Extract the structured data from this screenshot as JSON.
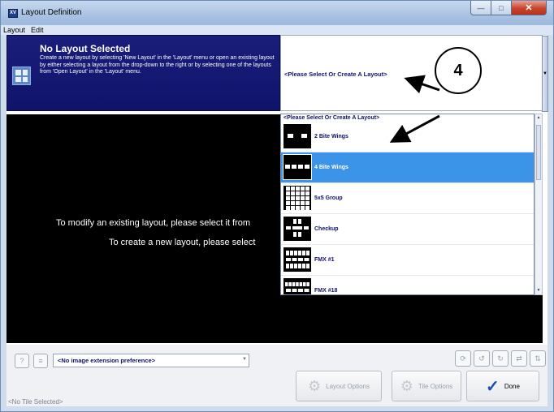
{
  "window": {
    "title": "Layout Definition",
    "icon_text": "XV"
  },
  "menu": {
    "items": [
      "Layout",
      "Edit"
    ]
  },
  "header": {
    "title": "No Layout Selected",
    "description": "Create a new layout by selecting 'New Layout' in the 'Layout' menu or open an existing layout by either selecting a layout from the drop-down to the right or by selecting one of the layouts from 'Open Layout' in the 'Layout' menu."
  },
  "layout_select": {
    "value": "<Please Select Or Create A Layout>"
  },
  "dropdown": {
    "header": "<Please Select Or Create A Layout>",
    "items": [
      {
        "label": "2 Bite Wings",
        "selected": false
      },
      {
        "label": "4 Bite Wings",
        "selected": true
      },
      {
        "label": "5x5 Group",
        "selected": false
      },
      {
        "label": "Checkup",
        "selected": false
      },
      {
        "label": "FMX #1",
        "selected": false
      },
      {
        "label": "FMX #18",
        "selected": false
      }
    ]
  },
  "preview": {
    "line1": "To modify an existing layout, please select it from",
    "line2": "To create a new layout, please select"
  },
  "callout": {
    "number": "4"
  },
  "bottom": {
    "extension_preference": "<No image extension preference>",
    "layout_options_label": "Layout Options",
    "tile_options_label": "Tile Options",
    "done_label": "Done",
    "status": "<No Tile Selected>"
  },
  "colors": {
    "header_bg": "#14187a",
    "selected_row": "#3c94e8",
    "label_text": "#10106a"
  }
}
